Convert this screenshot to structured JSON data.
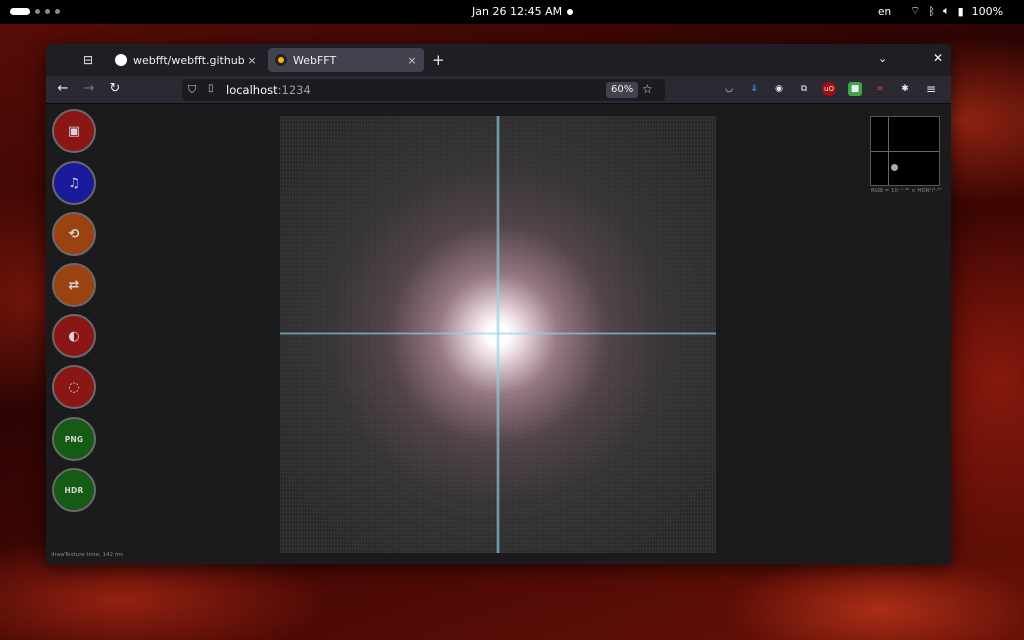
{
  "topbar": {
    "clock": "Jan 26  12:45 AM",
    "language": "en",
    "battery": "100%"
  },
  "browser": {
    "tabs": [
      {
        "title": "webfft/webfft.github.io",
        "close": "×"
      },
      {
        "title": "WebFFT",
        "close": "×"
      }
    ],
    "new_tab": "+",
    "url_host": "localhost",
    "url_port": ":1234",
    "zoom": "60%"
  },
  "app": {
    "buttons": [
      {
        "name": "open-image-button",
        "icon": "image-icon",
        "glyph": "▣",
        "color": "#8a1616"
      },
      {
        "name": "open-audio-button",
        "icon": "audio-file-icon",
        "glyph": "♫",
        "color": "#1a1a9a"
      },
      {
        "name": "rotate-button",
        "icon": "rotate-icon",
        "glyph": "⟲",
        "color": "#9a4210"
      },
      {
        "name": "swap-button",
        "icon": "swap-arrows-icon",
        "glyph": "⇄",
        "color": "#9a4210"
      },
      {
        "name": "half-dots-button",
        "icon": "half-circle-dots-icon",
        "glyph": "◐",
        "color": "#8a1616"
      },
      {
        "name": "dotted-circle-button",
        "icon": "dotted-circle-icon",
        "glyph": "◌",
        "color": "#8a1616"
      },
      {
        "name": "png-export-button",
        "icon": "png-icon",
        "glyph": "PNG",
        "color": "#155a15"
      },
      {
        "name": "hdr-export-button",
        "icon": "hdr-icon",
        "glyph": "HDR",
        "color": "#155a15"
      }
    ],
    "caption": "RGB = 10⁻¹·⁴⁸ × HDR¹/¹·⁵⁷",
    "status": "drawTexture time: 142 ms"
  }
}
